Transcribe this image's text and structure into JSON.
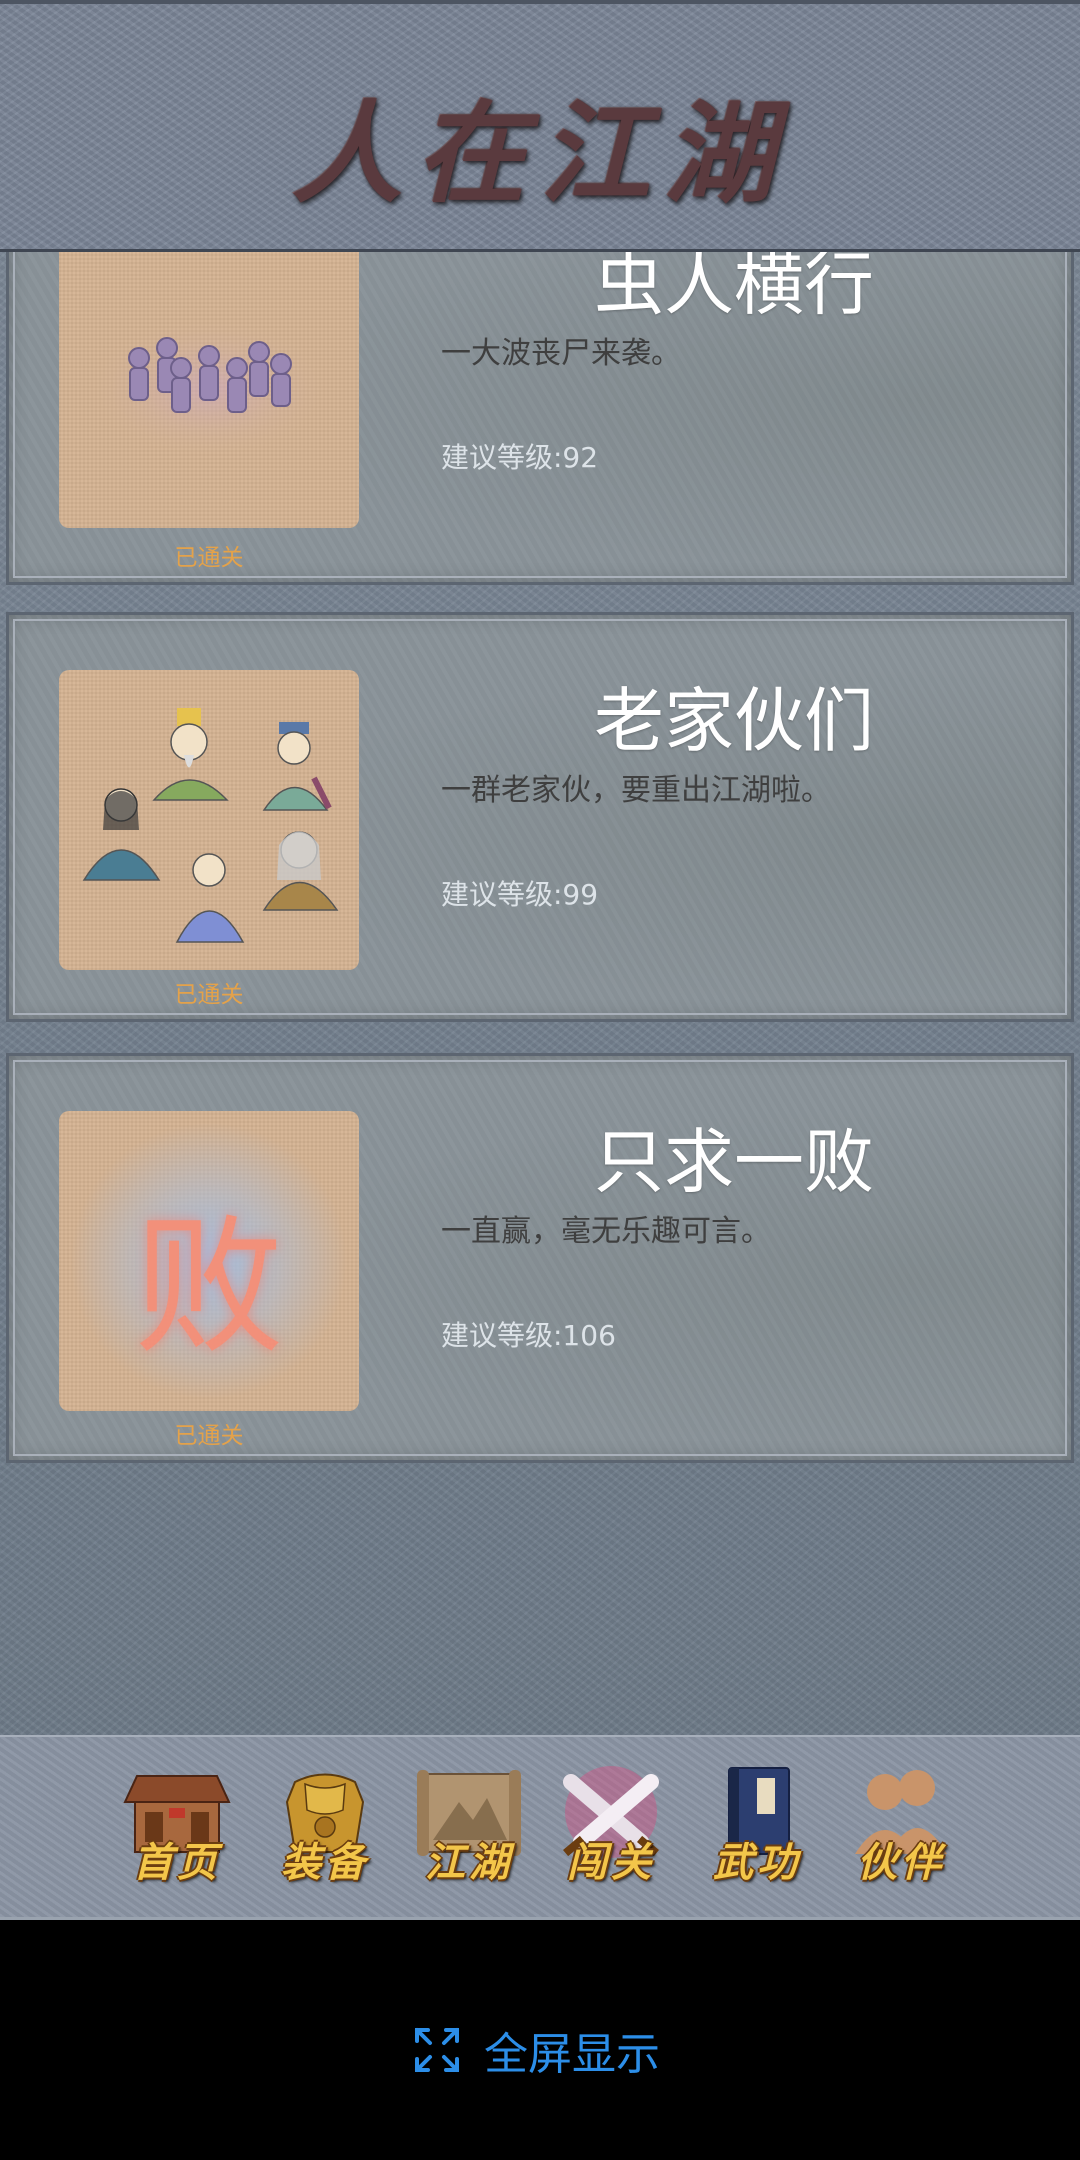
{
  "header": {
    "title": "人在江湖"
  },
  "levels": [
    {
      "name": "虫人横行",
      "description": "一大波丧尸来袭。",
      "level": "建议等级:92",
      "status": "已通关"
    },
    {
      "name": "老家伙们",
      "description": "一群老家伙，要重出江湖啦。",
      "level": "建议等级:99",
      "status": "已通关"
    },
    {
      "name": "只求一败",
      "description": "一直赢，毫无乐趣可言。",
      "level": "建议等级:106",
      "status": "已通关",
      "image_glyph": "败"
    }
  ],
  "nav": {
    "items": [
      {
        "label": "首页",
        "icon": "house-icon"
      },
      {
        "label": "装备",
        "icon": "armor-icon"
      },
      {
        "label": "江湖",
        "icon": "map-scroll-icon"
      },
      {
        "label": "闯关",
        "icon": "crossed-swords-icon",
        "active": true
      },
      {
        "label": "武功",
        "icon": "book-icon"
      },
      {
        "label": "伙伴",
        "icon": "partners-icon"
      }
    ]
  },
  "fullscreen": {
    "label": "全屏显示",
    "icon": "fullscreen-icon",
    "color": "#2c8ee8"
  },
  "colors": {
    "status": "#e4a24a",
    "title": "#5a3a3e",
    "nav_label": "#f3c64a"
  }
}
